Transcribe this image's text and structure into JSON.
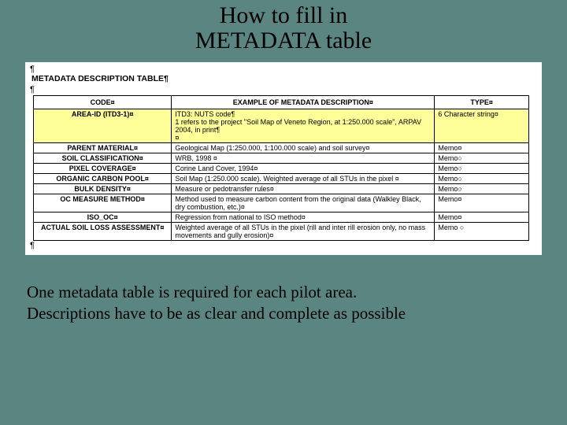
{
  "title_line1": "How to fill in",
  "title_line2": "METADATA table",
  "meta_header": "METADATA DESCRIPTION TABLE¶",
  "pilcrow": "¶",
  "columns": {
    "code": "CODE¤",
    "desc": "EXAMPLE OF METADATA DESCRIPTION¤",
    "type": "TYPE¤"
  },
  "rows": [
    {
      "code": "AREA-ID (ITD3-1)¤",
      "desc": "ITD3: NUTS code¶\n1 refers to the project \"Soil Map of Veneto Region, at 1:250.000 scale\", ARPAV 2004, in print¶\n¤",
      "type": "6 Character string¤",
      "hl": true
    },
    {
      "code": "PARENT MATERIAL¤",
      "desc": "Geological Map (1:250.000, 1:100.000 scale) and soil survey¤",
      "type": "Memo¤"
    },
    {
      "code": "SOIL CLASSIFICATION¤",
      "desc": "WRB, 1998 ¤",
      "type": "Memo○"
    },
    {
      "code": "PIXEL COVERAGE¤",
      "desc": "Corine Land Cover, 1994¤",
      "type": "Memo○"
    },
    {
      "code": "ORGANIC CARBON POOL¤",
      "desc": "Soil Map (1:250.000 scale). Weighted average of all STUs in the pixel ¤",
      "type": "Memo○"
    },
    {
      "code": "BULK DENSITY¤",
      "desc": "Measure or pedotransfer rules¤",
      "type": "Memo○"
    },
    {
      "code": "OC MEASURE METHOD¤",
      "desc": "Method used to measure carbon content from the original data (Walkley Black, dry combustion, etc.)¤",
      "type": "Memo¤"
    },
    {
      "code": "ISO_OC¤",
      "desc": "Regression from national to ISO method¤",
      "type": "Memo¤"
    },
    {
      "code": "ACTUAL SOIL LOSS ASSESSMENT¤",
      "desc": "Weighted average of all STUs in the pixel (rill and inter rill erosion only, no mass movements and gully erosion)¤",
      "type": "Memo ○"
    }
  ],
  "footer_line1": "One metadata table is required for each pilot area.",
  "footer_line2": "Descriptions have to be as clear and complete as possible"
}
